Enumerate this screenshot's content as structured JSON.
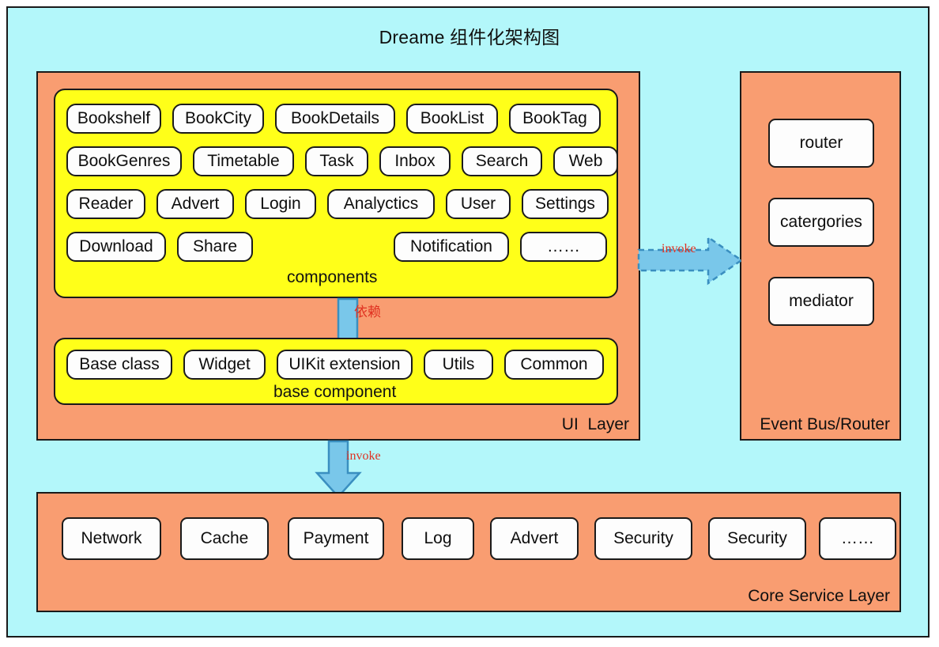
{
  "title": "Dreame 组件化架构图",
  "colors": {
    "background": "#b3f7fa",
    "panel": "#f99d71",
    "group": "#ffff19",
    "pill": "#fdfdfd",
    "border": "#1a1a1a",
    "arrow_fill": "#79c7ea",
    "arrow_stroke": "#3a8fc0",
    "label_red": "#e03020"
  },
  "ui_layer": {
    "label": "UI  Layer",
    "components": {
      "caption": "components",
      "rows": [
        [
          "Bookshelf",
          "BookCity",
          "BookDetails",
          "BookList",
          "BookTag"
        ],
        [
          "BookGenres",
          "Timetable",
          "Task",
          "Inbox",
          "Search",
          "Web"
        ],
        [
          "Reader",
          "Advert",
          "Login",
          "Analyctics",
          "User",
          "Settings"
        ],
        [
          "Download",
          "Share",
          "Notification",
          "……"
        ]
      ]
    },
    "base_component": {
      "caption": "base component",
      "items": [
        "Base class",
        "Widget",
        "UIKit extension",
        "Utils",
        "Common"
      ]
    }
  },
  "event_bus": {
    "label": "Event Bus/Router",
    "items": [
      "router",
      "catergories",
      "mediator"
    ]
  },
  "core_service": {
    "label": "Core Service Layer",
    "items": [
      "Network",
      "Cache",
      "Payment",
      "Log",
      "Advert",
      "Security",
      "Security",
      "……"
    ]
  },
  "arrows": {
    "dependency": "依赖",
    "invoke_right": "invoke",
    "invoke_down": "invoke"
  }
}
